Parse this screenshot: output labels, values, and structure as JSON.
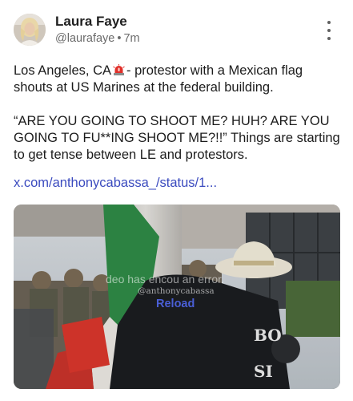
{
  "post": {
    "author_name": "Laura Faye",
    "handle": "@laurafaye",
    "separator": "•",
    "time_ago": "7m",
    "text_line1_before": "Los Angeles, CA",
    "text_line1_after": "- protestor with a Mexican flag shouts at US Marines at the federal building.",
    "text_paragraph2": "“ARE YOU GOING TO SHOOT ME? HUH? ARE YOU GOING TO FU**ING SHOOT ME?!!” Things are starting to get tense between LE and protestors.",
    "link_text": "x.com/anthonycabassa_/status/1..."
  },
  "icons": {
    "avatar": "user-avatar-photo",
    "more": "more-vertical-icon",
    "siren": "police-siren-emoji"
  },
  "video": {
    "error_text": "deo has encou      an error.",
    "watermark": "@anthonycabassa",
    "reload_label": "Reload"
  },
  "colors": {
    "link": "#3b4bbf",
    "reload": "#4a5fd6",
    "meta": "#6b6b6b"
  }
}
